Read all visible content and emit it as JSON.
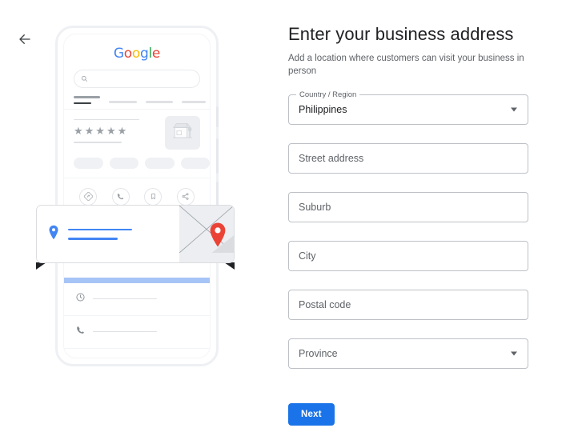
{
  "nav": {
    "back_label": "Back",
    "back_icon": "arrow-left-icon"
  },
  "illustration": {
    "phone": {
      "brand_logo": {
        "icon": "google-logo",
        "letters": [
          {
            "char": "G",
            "color": "#4285F4"
          },
          {
            "char": "o",
            "color": "#EA4335"
          },
          {
            "char": "o",
            "color": "#FBBC05"
          },
          {
            "char": "g",
            "color": "#4285F4"
          },
          {
            "char": "l",
            "color": "#34A853"
          },
          {
            "char": "e",
            "color": "#EA4335"
          }
        ]
      },
      "search_icon": "search-icon",
      "rating_stars": "★★★★★",
      "thumbnail_icon": "storefront-icon",
      "action_icons": [
        "directions-icon",
        "phone-icon",
        "bookmark-icon",
        "share-icon"
      ],
      "detail_icons": [
        "clock-icon",
        "phone-icon",
        "globe-icon"
      ]
    },
    "map_card": {
      "pin_icon": "location-pin-icon",
      "map_pin_icon": "map-marker-icon",
      "accent_color": "#4285F4",
      "marker_color": "#EA4335"
    }
  },
  "form": {
    "title": "Enter your business address",
    "subtitle": "Add a location where customers can visit your business in person",
    "fields": [
      {
        "name": "country-region",
        "label": "Country / Region",
        "value": "Philippines",
        "type": "select"
      },
      {
        "name": "street-address",
        "placeholder": "Street address",
        "type": "text"
      },
      {
        "name": "suburb",
        "placeholder": "Suburb",
        "type": "text"
      },
      {
        "name": "city",
        "placeholder": "City",
        "type": "text"
      },
      {
        "name": "postal-code",
        "placeholder": "Postal code",
        "type": "text"
      },
      {
        "name": "province",
        "placeholder": "Province",
        "type": "select"
      }
    ],
    "submit_label": "Next",
    "accent_color": "#1a73e8"
  }
}
